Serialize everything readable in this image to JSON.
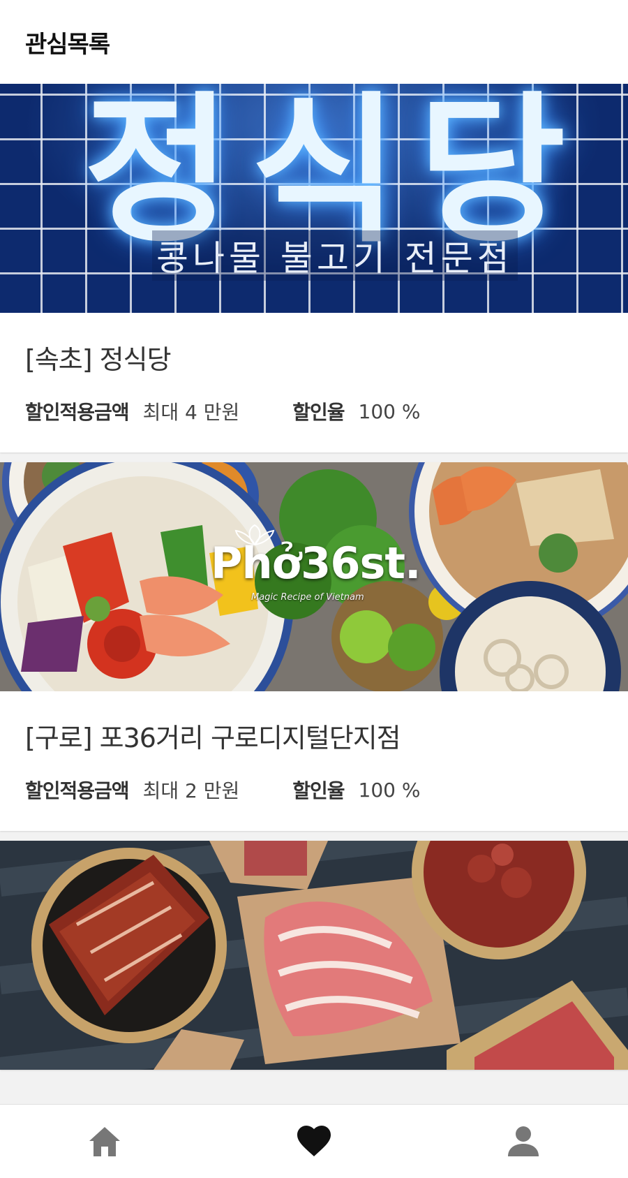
{
  "header": {
    "title": "관심목록"
  },
  "cards": [
    {
      "title": "[속초] 정식당",
      "discount_amount_label": "할인적용금액",
      "discount_amount_value": "최대 4 만원",
      "discount_rate_label": "할인율",
      "discount_rate_value": "100 %",
      "image": {
        "sign_text": "정식당",
        "subtitle": "콩나물 불고기 전문점"
      }
    },
    {
      "title": "[구로] 포36거리 구로디지털단지점",
      "discount_amount_label": "할인적용금액",
      "discount_amount_value": "최대 2 만원",
      "discount_rate_label": "할인율",
      "discount_rate_value": "100 %",
      "image": {
        "brand": "Phở36st.",
        "tagline": "Magic Recipe of Vietnam"
      }
    },
    {
      "title": "",
      "image": {}
    }
  ],
  "nav": {
    "items": [
      {
        "icon": "home-icon",
        "active": false
      },
      {
        "icon": "heart-icon",
        "active": true
      },
      {
        "icon": "user-icon",
        "active": false
      }
    ]
  },
  "colors": {
    "active": "#111111",
    "inactive": "#777777"
  }
}
